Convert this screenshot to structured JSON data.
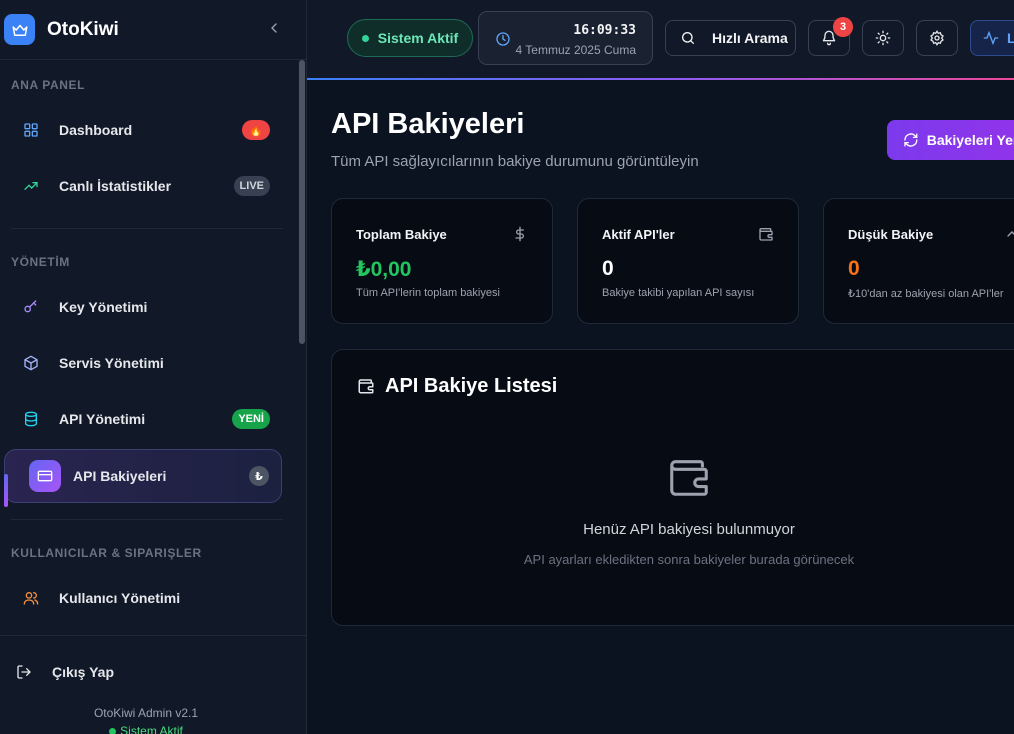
{
  "brand": {
    "name": "OtoKiwi"
  },
  "sidebar": {
    "sections": [
      {
        "title": "ANA PANEL"
      },
      {
        "title": "YÖNETİM"
      },
      {
        "title": "KULLANICILAR & SIPARIŞLER"
      }
    ],
    "items": [
      {
        "label": "Dashboard",
        "icon": "grid-icon",
        "badge": "🔥"
      },
      {
        "label": "Canlı İstatistikler",
        "icon": "trending-up-icon",
        "badge": "LIVE"
      },
      {
        "label": "Key Yönetimi",
        "icon": "key-icon"
      },
      {
        "label": "Servis Yönetimi",
        "icon": "box-icon"
      },
      {
        "label": "API Yönetimi",
        "icon": "database-icon",
        "badge": "YENİ"
      },
      {
        "label": "API Bakiyeleri",
        "icon": "credit-card-icon",
        "badge": "₺",
        "active": true
      },
      {
        "label": "Kullanıcı Yönetimi",
        "icon": "users-icon"
      }
    ],
    "logout_label": "Çıkış Yap",
    "version": "OtoKiwi Admin v2.1",
    "status": "Sistem Aktif"
  },
  "header": {
    "status_label": "Sistem Aktif",
    "time": "16:09:33",
    "date": "4 Temmuz 2025 Cuma",
    "search_label": "Hızlı Arama",
    "notification_count": "3",
    "live_label": "L"
  },
  "main": {
    "title": "API Bakiyeleri",
    "subtitle": "Tüm API sağlayıcılarının bakiye durumunu görüntüleyin",
    "refresh_label": "Bakiyeleri Yenile",
    "cards": [
      {
        "title": "Toplam Bakiye",
        "value": "₺0,00",
        "desc": "Tüm API'lerin toplam bakiyesi",
        "color": "#22c55e"
      },
      {
        "title": "Aktif API'ler",
        "value": "0",
        "desc": "Bakiye takibi yapılan API sayısı",
        "color": "#ffffff"
      },
      {
        "title": "Düşük Bakiye",
        "value": "0",
        "desc": "₺10'dan az bakiyesi olan API'ler",
        "color": "#f97316"
      }
    ],
    "list": {
      "title": "API Bakiye Listesi",
      "empty_title": "Henüz API bakiyesi bulunmuyor",
      "empty_desc": "API ayarları ekledikten sonra bakiyeler burada görünecek"
    }
  },
  "colors": {
    "accent": "#3b82f6",
    "brand_purple": "#7c3aed",
    "success": "#22c55e",
    "warning": "#f97316",
    "danger": "#ef4444"
  }
}
